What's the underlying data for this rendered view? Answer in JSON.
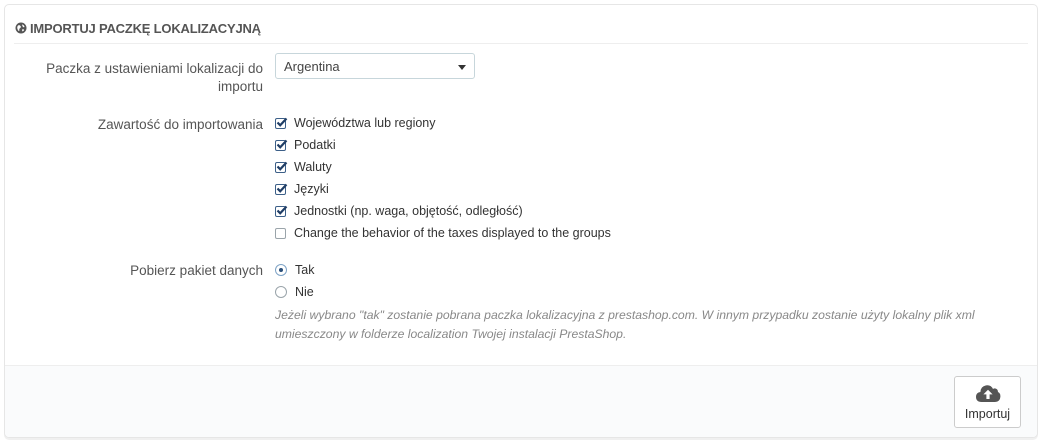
{
  "heading": {
    "icon": "globe-icon",
    "title": "IMPORTUJ PACZKĘ LOKALIZACYJNĄ"
  },
  "form": {
    "pack_label_line1": "Paczka z ustawieniami lokalizacji do",
    "pack_label_line2": "importu",
    "pack_selected": "Argentina",
    "content_label": "Zawartość do importowania",
    "content_options": [
      {
        "label": "Województwa lub regiony",
        "checked": true
      },
      {
        "label": "Podatki",
        "checked": true
      },
      {
        "label": "Waluty",
        "checked": true
      },
      {
        "label": "Języki",
        "checked": true
      },
      {
        "label": "Jednostki (np. waga, objętość, odległość)",
        "checked": true
      },
      {
        "label": "Change the behavior of the taxes displayed to the groups",
        "checked": false
      }
    ],
    "download_label": "Pobierz pakiet danych",
    "download_options": [
      {
        "label": "Tak",
        "checked": true
      },
      {
        "label": "Nie",
        "checked": false
      }
    ],
    "help_text": "Jeżeli wybrano \"tak\" zostanie pobrana paczka lokalizacyjna z prestashop.com. W innym przypadku zostanie użyty lokalny plik xml umieszczony w folderze localization Twojej instalacji PrestaShop."
  },
  "footer": {
    "import_button": "Importuj",
    "import_icon": "cloud-upload-icon"
  },
  "colors": {
    "checkbox_checked": "#3c5f88",
    "border": "#e6e6e6"
  }
}
